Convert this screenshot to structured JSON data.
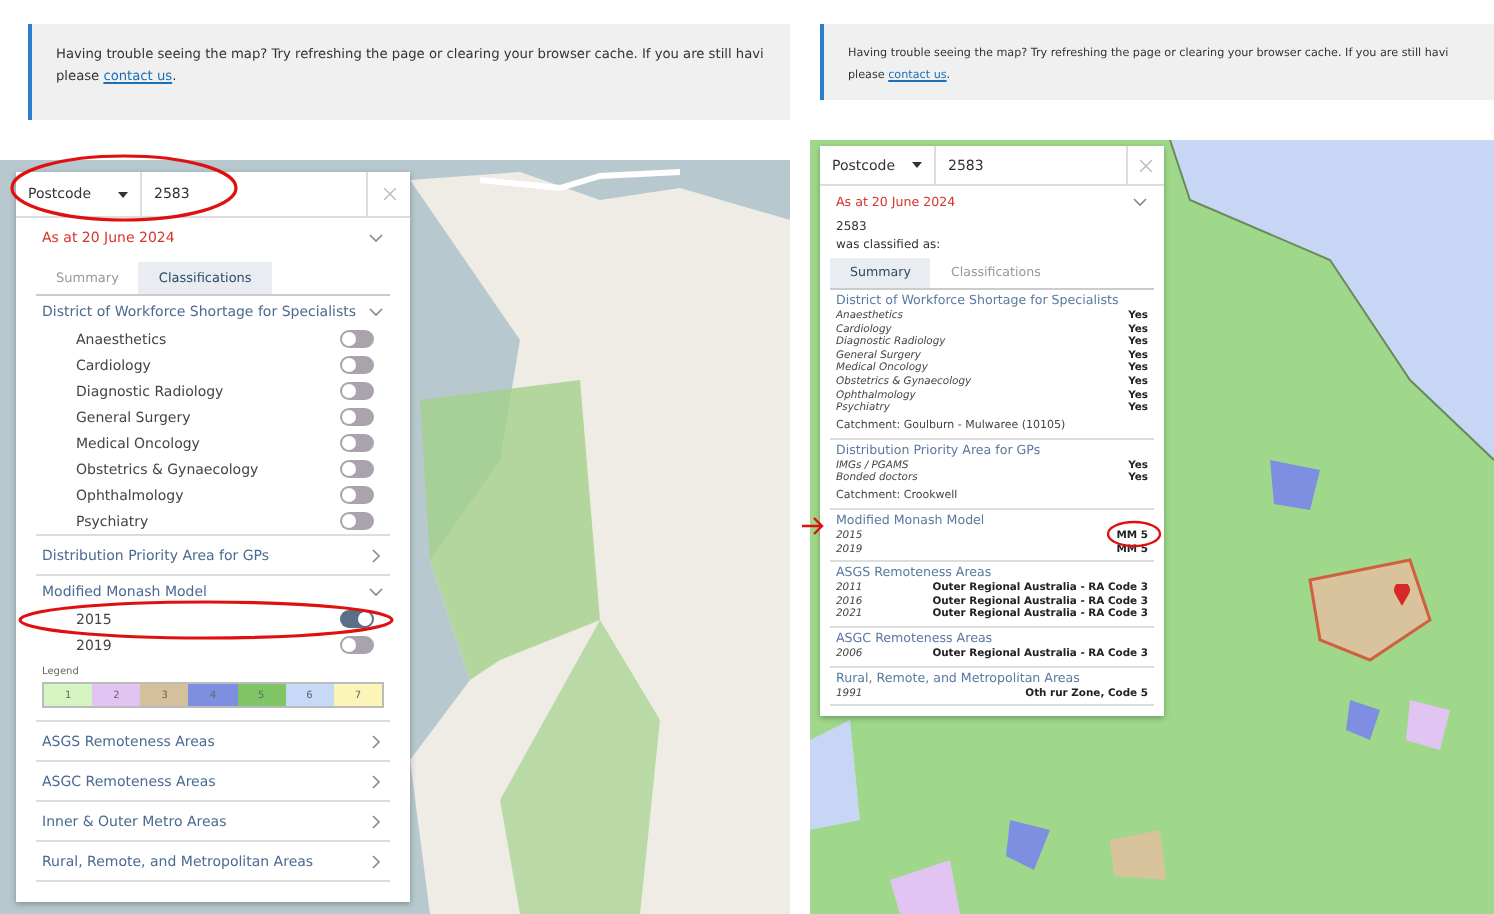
{
  "screens": [
    {
      "notice": {
        "text": "Having trouble seeing the map? Try refreshing the page or clearing your browser cache. If you are still havi",
        "line2": "please ",
        "link": "contact us",
        "end": "."
      },
      "panel": {
        "search": {
          "type": "Postcode",
          "value": "2583"
        },
        "date": "As at 20 June 2024",
        "expanded": true,
        "tabs": [
          {
            "label": "Summary",
            "selected": false
          },
          {
            "label": "Classifications",
            "selected": true
          }
        ],
        "sections": [
          {
            "title": "District of Workforce Shortage for Specialists",
            "kind": "toggles",
            "expanded": true,
            "items": [
              {
                "label": "Anaesthetics",
                "on": false
              },
              {
                "label": "Cardiology",
                "on": false
              },
              {
                "label": "Diagnostic Radiology",
                "on": false
              },
              {
                "label": "General Surgery",
                "on": false
              },
              {
                "label": "Medical Oncology",
                "on": false
              },
              {
                "label": "Obstetrics & Gynaecology",
                "on": false
              },
              {
                "label": "Ophthalmology",
                "on": false
              },
              {
                "label": "Psychiatry",
                "on": false
              }
            ]
          },
          {
            "title": "Distribution Priority Area for GPs",
            "kind": "toggles",
            "expanded": false
          },
          {
            "title": "Modified Monash Model",
            "kind": "toggles",
            "expanded": true,
            "items": [
              {
                "label": "2015",
                "on": true
              },
              {
                "label": "2019",
                "on": false
              }
            ],
            "legend": {
              "title": "Legend",
              "items": [
                {
                  "label": "1",
                  "color": "#d4f5c2"
                },
                {
                  "label": "2",
                  "color": "#e2c4f2"
                },
                {
                  "label": "3",
                  "color": "#d4c19c"
                },
                {
                  "label": "4",
                  "color": "#7e8fe2"
                },
                {
                  "label": "5",
                  "color": "#80c565"
                },
                {
                  "label": "6",
                  "color": "#c6d9f6"
                },
                {
                  "label": "7",
                  "color": "#fbf6b8"
                }
              ]
            }
          },
          {
            "title": "ASGS Remoteness Areas",
            "kind": "toggles",
            "expanded": false
          },
          {
            "title": "ASGC Remoteness Areas",
            "kind": "toggles",
            "expanded": false
          },
          {
            "title": "Inner & Outer Metro Areas",
            "kind": "toggles",
            "expanded": false
          },
          {
            "title": "Rural, Remote, and Metropolitan Areas",
            "kind": "toggles",
            "expanded": false
          }
        ]
      }
    },
    {
      "notice": {
        "text": "Having trouble seeing the map? Try refreshing the page or clearing your browser cache. If you are still havi",
        "line2": "please ",
        "link": "contact us",
        "end": "."
      },
      "panel": {
        "search": {
          "type": "Postcode",
          "value": "2583"
        },
        "date": "As at 20 June 2024",
        "expanded": true,
        "result": {
          "code": "2583",
          "caption": "was classified as:"
        },
        "tabs": [
          {
            "label": "Summary",
            "selected": true
          },
          {
            "label": "Classifications",
            "selected": false
          }
        ],
        "sections": [
          {
            "title": "District of Workforce Shortage for Specialists",
            "kind": "rows",
            "items": [
              {
                "label": "Anaesthetics",
                "value": "Yes"
              },
              {
                "label": "Cardiology",
                "value": "Yes"
              },
              {
                "label": "Diagnostic Radiology",
                "value": "Yes"
              },
              {
                "label": "General Surgery",
                "value": "Yes"
              },
              {
                "label": "Medical Oncology",
                "value": "Yes"
              },
              {
                "label": "Obstetrics & Gynaecology",
                "value": "Yes"
              },
              {
                "label": "Ophthalmology",
                "value": "Yes"
              },
              {
                "label": "Psychiatry",
                "value": "Yes"
              }
            ],
            "catchment": "Catchment: Goulburn - Mulwaree (10105)"
          },
          {
            "title": "Distribution Priority Area for GPs",
            "kind": "rows",
            "items": [
              {
                "label": "IMGs / PGAMS",
                "value": "Yes"
              },
              {
                "label": "Bonded doctors",
                "value": "Yes"
              }
            ],
            "catchment": "Catchment: Crookwell"
          },
          {
            "title": "Modified Monash Model",
            "kind": "rows",
            "items": [
              {
                "label": "2015",
                "value": "MM 5"
              },
              {
                "label": "2019",
                "value": "MM 5"
              }
            ]
          },
          {
            "title": "ASGS Remoteness Areas",
            "kind": "rows",
            "items": [
              {
                "label": "2011",
                "value": "Outer Regional Australia - RA Code 3"
              },
              {
                "label": "2016",
                "value": "Outer Regional Australia - RA Code 3"
              },
              {
                "label": "2021",
                "value": "Outer Regional Australia - RA Code 3"
              }
            ]
          },
          {
            "title": "ASGC Remoteness Areas",
            "kind": "rows",
            "items": [
              {
                "label": "2006",
                "value": "Outer Regional Australia - RA Code 3"
              }
            ]
          },
          {
            "title": "Rural, Remote, and Metropolitan Areas",
            "kind": "rows",
            "items": [
              {
                "label": "1991",
                "value": "Oth rur Zone, Code 5"
              }
            ]
          }
        ]
      }
    }
  ]
}
